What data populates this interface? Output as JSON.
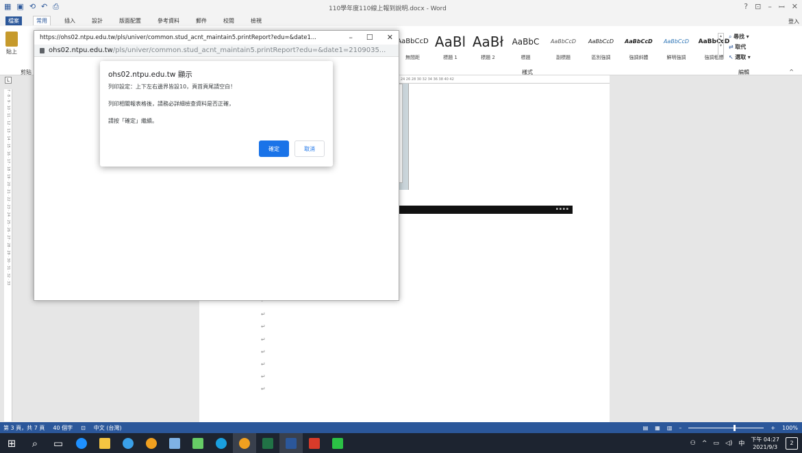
{
  "word": {
    "doc_title": "110學年度110線上報到說明.docx - Word",
    "win_controls": [
      "?",
      "⊡",
      "–",
      "ꟷ",
      "✕"
    ],
    "quick_access": [
      "⟲",
      "↶",
      "⎙"
    ],
    "login": "登入",
    "tabs": [
      "檔案",
      "常用",
      "插入",
      "設計",
      "版面配置",
      "參考資料",
      "郵件",
      "校閱",
      "檢視"
    ],
    "ribbon": {
      "paste_label": "貼上",
      "clipboard_label": "剪貼",
      "styles": [
        {
          "sample": "AaBbCcD",
          "name": "無間距"
        },
        {
          "sample": "AaBl",
          "name": "標題 1"
        },
        {
          "sample": "AaBł",
          "name": "標題 2"
        },
        {
          "sample": "AaBbC",
          "name": "標題"
        },
        {
          "sample": "AaBbCcD",
          "name": "副標題"
        },
        {
          "sample": "AaBbCcD",
          "name": "區別強調"
        },
        {
          "sample": "AaBbCcD",
          "name": "強調斜體"
        },
        {
          "sample": "AaBbCcD",
          "name": "鮮明強調"
        },
        {
          "sample": "AaBbCcD",
          "name": "強調粗體"
        }
      ],
      "styles_group_label": "樣式",
      "find_label": "尋找",
      "replace_label": "取代",
      "select_label": "選取",
      "editing_group_label": "編輯"
    },
    "ruler_h_text": "18  20  22  24  26  28  30  32  34  36  38  40  42",
    "ruler_v_text": "7 · 8 · 9 · 10 · 11 · 12 · 13 · 14 · 15 · 16 · 17 · 18 · 19 · 20 · 21 · 22 · 23 · 24 · 25 · 26 · 27 · 28 · 29 · 30 · 31 · 32 · 33",
    "status": {
      "page": "第 3 頁，共 7 頁",
      "words": "40 個字",
      "language": "中文 (台灣)",
      "zoom": "100%"
    }
  },
  "browser": {
    "title": "https://ohs02.ntpu.edu.tw/pls/univer/common.stud_acnt_maintain5.printReport?edu=&date1...",
    "url_host": "ohs02.ntpu.edu.tw",
    "url_rest": "/pls/univer/common.stud_acnt_maintain5.printReport?edu=&date1=2109035..."
  },
  "dialog": {
    "title": "ohs02.ntpu.edu.tw 顯示",
    "line1": "列印設定：上下左右邊界皆設10，頁首頁尾請空白！",
    "line2": "列印相關報表格後，請務必詳細檢查資料是否正確，",
    "line3": "請按「確定」繼續。",
    "ok": "確定",
    "cancel": "取消"
  },
  "taskbar": {
    "time": "下午 04:27",
    "date": "2021/9/3",
    "ime": "中",
    "notifications": "2"
  }
}
